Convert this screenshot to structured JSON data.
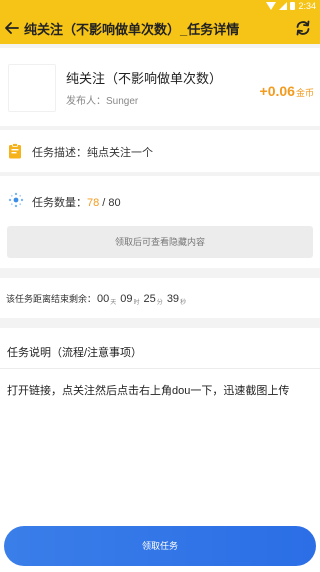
{
  "status_bar": {
    "time": "2:34",
    "icons": [
      "wifi-icon",
      "signal-icon",
      "battery-icon"
    ]
  },
  "app_bar": {
    "title": "纯关注（不影响做单次数）_任务详情",
    "back_icon": "back-arrow-icon",
    "refresh_icon": "refresh-icon"
  },
  "task": {
    "name": "纯关注（不影响做单次数）",
    "publisher": "发布人：Sunger",
    "reward_amount": "+0.06",
    "reward_unit": "金币"
  },
  "description": {
    "text": "任务描述：纯点关注一个"
  },
  "quantity": {
    "label": "任务数量：",
    "done": "78",
    "separator": " / ",
    "total": "80",
    "hidden_hint": "领取后可查看隐藏内容"
  },
  "countdown": {
    "label": "该任务距离结束剩余：",
    "days": "00",
    "days_unit": "天",
    "hours": "09",
    "hours_unit": "时",
    "minutes": "25",
    "minutes_unit": "分",
    "seconds": "39",
    "seconds_unit": "秒"
  },
  "notes": {
    "title": "任务说明（流程/注意事项）",
    "body": "打开链接，点关注然后点击右上角dou一下，迅速截图上传"
  },
  "accept_button": {
    "label": "领取任务"
  },
  "colors": {
    "brand_yellow": "#f6c417",
    "reward_orange": "#f29b1f",
    "button_blue": "#2b6ee6"
  }
}
